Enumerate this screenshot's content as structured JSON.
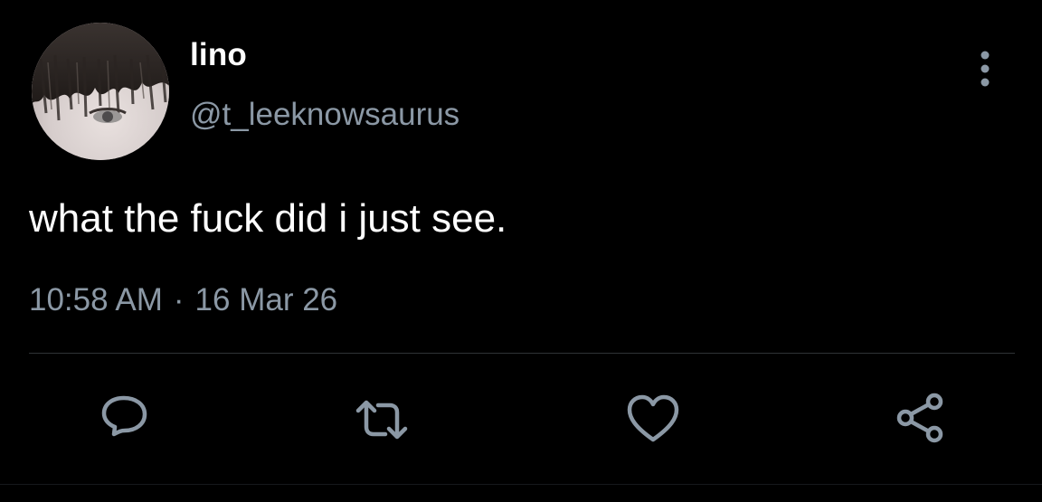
{
  "tweet": {
    "display_name": "lino",
    "handle": "@t_leeknowsaurus",
    "text": "what the fuck did i just see.",
    "time": "10:58 AM",
    "separator": "·",
    "date": "16 Mar 26"
  },
  "icons": {
    "more": "more-vertical-icon",
    "reply": "reply-icon",
    "retweet": "retweet-icon",
    "like": "heart-icon",
    "share": "share-icon"
  },
  "colors": {
    "background": "#000000",
    "primary_text": "#ffffff",
    "secondary_text": "#8b98a5",
    "icon": "#8b98a5",
    "divider": "#2f3336"
  }
}
